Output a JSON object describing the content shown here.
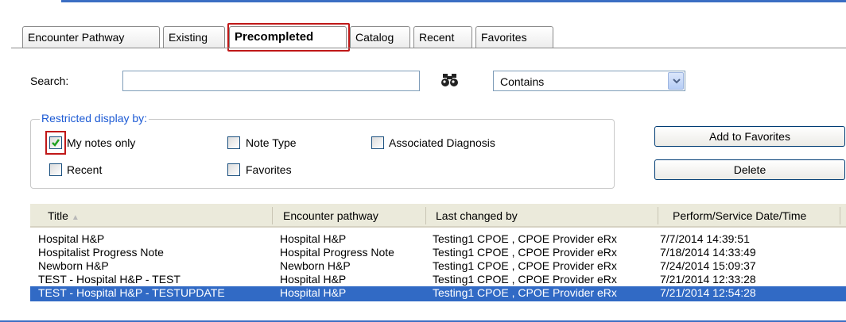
{
  "tabs": [
    {
      "label": "Encounter Pathway",
      "active": false
    },
    {
      "label": "Existing",
      "active": false
    },
    {
      "label": "Precompleted",
      "active": true
    },
    {
      "label": "Catalog",
      "active": false
    },
    {
      "label": "Recent",
      "active": false
    },
    {
      "label": "Favorites",
      "active": false
    }
  ],
  "search": {
    "label": "Search:",
    "value": "",
    "icon": "binoculars-icon",
    "match_mode": "Contains"
  },
  "restrict": {
    "title": "Restricted display by:",
    "options": [
      {
        "label": "My notes only",
        "checked": true
      },
      {
        "label": "Note Type",
        "checked": false
      },
      {
        "label": "Associated Diagnosis",
        "checked": false
      },
      {
        "label": "Recent",
        "checked": false
      },
      {
        "label": "Favorites",
        "checked": false
      }
    ]
  },
  "buttons": {
    "add_favorites": "Add to Favorites",
    "delete": "Delete"
  },
  "table": {
    "columns": [
      "Title",
      "Encounter pathway",
      "Last changed by",
      "Perform/Service Date/Time"
    ],
    "sort_indicator": "▲",
    "rows": [
      [
        "Hospital H&P",
        "Hospital H&P",
        "Testing1 CPOE , CPOE Provider eRx",
        "7/7/2014 14:39:51"
      ],
      [
        "Hospitalist Progress Note",
        "Hospital Progress Note",
        "Testing1 CPOE , CPOE Provider eRx",
        "7/18/2014 14:33:49"
      ],
      [
        "Newborn H&P",
        "Newborn H&P",
        "Testing1 CPOE , CPOE Provider eRx",
        "7/24/2014 15:09:37"
      ],
      [
        "TEST - Hospital H&P - TEST",
        "Hospital H&P",
        "Testing1 CPOE , CPOE Provider eRx",
        "7/21/2014 12:33:28"
      ],
      [
        "TEST - Hospital H&P - TESTUPDATE",
        "Hospital H&P",
        "Testing1 CPOE , CPOE Provider eRx",
        "7/21/2014 12:54:28"
      ]
    ],
    "selected_row": 4
  },
  "colors": {
    "accent": "#316ac5",
    "highlight_box": "#c01818",
    "group_title": "#1c5ad4"
  }
}
